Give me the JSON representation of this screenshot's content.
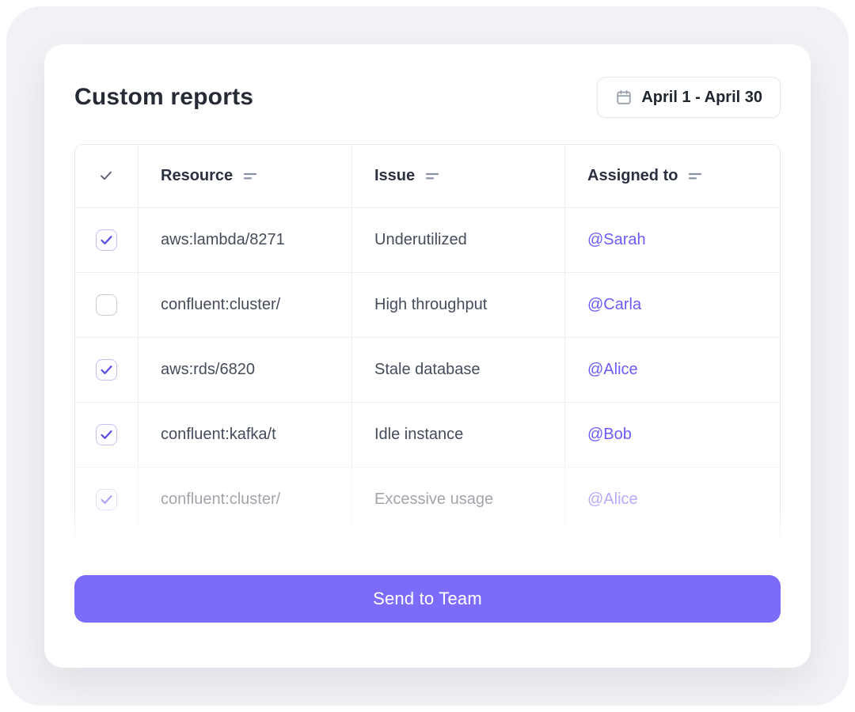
{
  "header": {
    "title": "Custom reports",
    "date_range_label": "April 1 - April 30"
  },
  "table": {
    "columns": [
      {
        "label": "",
        "icon": "check-icon",
        "sortable": false
      },
      {
        "label": "Resource",
        "icon": "sort-icon",
        "sortable": true
      },
      {
        "label": "Issue",
        "icon": "sort-icon",
        "sortable": true
      },
      {
        "label": "Assigned to",
        "icon": "sort-icon",
        "sortable": true
      }
    ],
    "rows": [
      {
        "checked": true,
        "resource": "aws:lambda/8271",
        "issue": "Underutilized",
        "assigned": "@Sarah",
        "state": "normal"
      },
      {
        "checked": false,
        "resource": "confluent:cluster/",
        "issue": "High throughput",
        "assigned": "@Carla",
        "state": "normal"
      },
      {
        "checked": true,
        "resource": "aws:rds/6820",
        "issue": "Stale database",
        "assigned": "@Alice",
        "state": "normal"
      },
      {
        "checked": true,
        "resource": "confluent:kafka/t",
        "issue": "Idle instance",
        "assigned": "@Bob",
        "state": "normal"
      },
      {
        "checked": true,
        "resource": "confluent:cluster/",
        "issue": "Excessive usage",
        "assigned": "@Alice",
        "state": "muted"
      },
      {
        "checked": true,
        "resource": "",
        "issue": "",
        "assigned": "",
        "state": "ghost"
      }
    ]
  },
  "actions": {
    "send_label": "Send to Team"
  },
  "colors": {
    "accent_button": "#7c6cfa",
    "mention_link": "#6c5cf6",
    "checkbox_check": "#5b4ce6",
    "title_text": "#262b35",
    "table_border": "#e7e9ee"
  }
}
